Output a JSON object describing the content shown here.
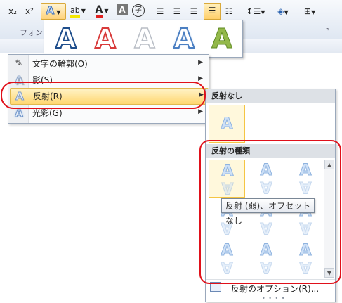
{
  "ribbon": {
    "subscript": "x₂",
    "superscript": "x²",
    "text_effects_glyph": "A",
    "highlight_glyph": "ab",
    "font_color_glyph": "A",
    "char_shading_glyph": "A",
    "enclosed_char_glyph": "字",
    "font_group_label": "フォント",
    "dialog_launcher": "⌝",
    "highlight_color": "#f3e600",
    "font_color": "#e02020"
  },
  "gallery": {
    "letter": "A",
    "styles": [
      "blue-outline",
      "red-outline",
      "light-outline",
      "blue-glow",
      "green-bevel"
    ]
  },
  "menu": {
    "items": [
      {
        "label": "文字の輪郭(O)",
        "icon": "pen-outline-icon",
        "active": false
      },
      {
        "label": "影(S)",
        "icon": "shadow-a-icon",
        "active": false
      },
      {
        "label": "反射(R)",
        "icon": "reflection-a-icon",
        "active": true
      },
      {
        "label": "光彩(G)",
        "icon": "glow-a-icon",
        "active": false
      }
    ],
    "arrow": "▶"
  },
  "submenu": {
    "no_reflection_header": "反射なし",
    "variants_header": "反射の種類",
    "letter": "A",
    "tooltip": "反射 (弱)、オフセットなし",
    "options_label": "反射のオプション(R)...",
    "grip": "• • • •",
    "scroll_up": "▲",
    "scroll_down": "▼"
  }
}
